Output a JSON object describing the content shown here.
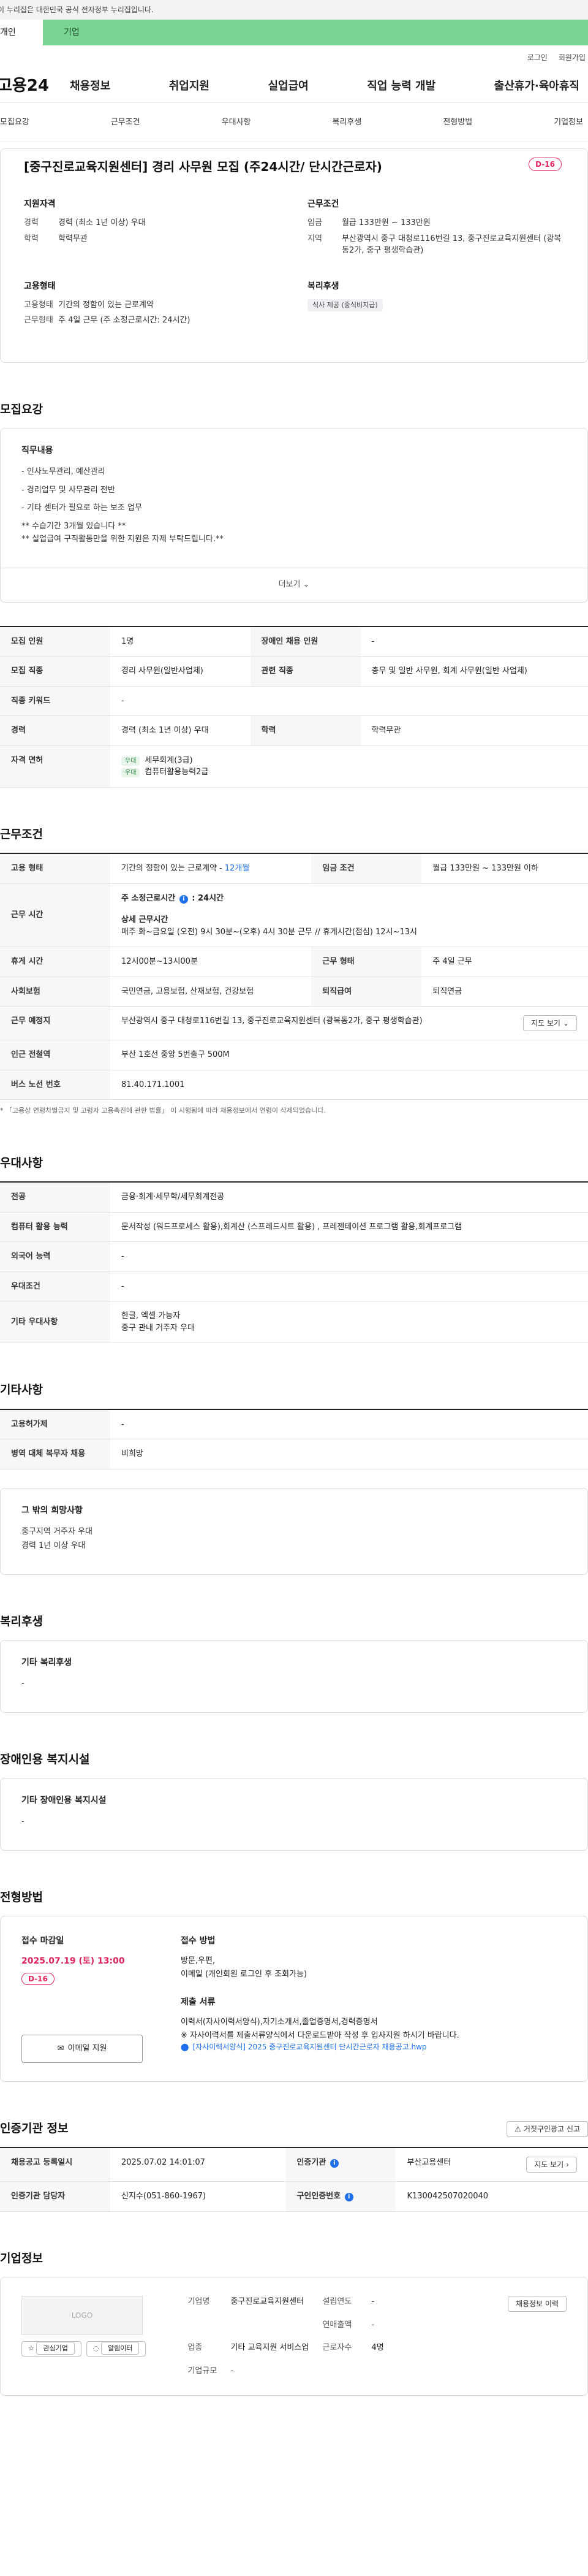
{
  "gov_notice": "이 누리집은 대한민국 공식 전자정부 누리집입니다.",
  "user_tabs": [
    "개인",
    "기업"
  ],
  "top_links": [
    "로그인",
    "회원가입"
  ],
  "logo": "고용24",
  "gnb": [
    "채용정보",
    "취업지원",
    "실업급여",
    "직업 능력 개발",
    "출산휴가·육아휴직"
  ],
  "anchors": [
    "모집요강",
    "근무조건",
    "우대사항",
    "복리후생",
    "전형방법",
    "기업정보"
  ],
  "job": {
    "title": "[중구진로교육지원센터] 경리 사무원 모집 (주24시간/ 단시간근로자)",
    "dday": "D-16",
    "summary": {
      "qual_title": "지원자격",
      "qual": [
        {
          "k": "경력",
          "v": "경력 (최소 1년 이상) 우대"
        },
        {
          "k": "학력",
          "v": "학력무관"
        }
      ],
      "cond_title": "근무조건",
      "cond": [
        {
          "k": "임금",
          "v": "월급 133만원 ~ 133만원"
        },
        {
          "k": "지역",
          "v": "부산광역시 중구 대청로116번길 13, 중구진로교육지원센터 (광복동2가, 중구 평생학습관)"
        }
      ],
      "emp_title": "고용형태",
      "emp": [
        {
          "k": "고용형태",
          "v": "기간의 정함이 있는 근로계약"
        },
        {
          "k": "근무형태",
          "v": "주 4일 근무 (주 소정근로시간: 24시간)"
        }
      ],
      "welfare_title": "복리후생",
      "welfare_chip": "식사 제공 (중식비지급)"
    }
  },
  "recruit": {
    "title": "모집요강",
    "duty_title": "직무내용",
    "duty_lines": [
      "- 인사노무관리, 예산관리",
      "- 경리업무 및 사무관리 전반",
      "- 기타 센터가 필요로 하는 보조 업무",
      "** 수습기간 3개월 있습니다 **",
      "** 실업급여 구직활동만을 위한 지원은 자제 부탁드립니다.**"
    ],
    "more": "더보기",
    "rows": [
      {
        "k": "모집 인원",
        "v": "1명",
        "k2": "장애인 채용 인원",
        "v2": "-"
      },
      {
        "k": "모집 직종",
        "v": "경리 사무원(일반사업체)",
        "k2": "관련 직종",
        "v2": "총무 및 일반 사무원, 회계 사무원(일반 사업체)"
      },
      {
        "k": "직종 키워드",
        "v": "-"
      },
      {
        "k": "경력",
        "v": "경력 (최소 1년 이상) 우대",
        "k2": "학력",
        "v2": "학력무관"
      }
    ],
    "license_k": "자격 면허",
    "licenses": [
      {
        "grade": "우대",
        "name": "세무회계(3급)"
      },
      {
        "grade": "우대",
        "name": "컴퓨터활용능력2급"
      }
    ]
  },
  "work": {
    "title": "근무조건",
    "emp_k": "고용 형태",
    "emp_v": "기간의 정함이 있는 근로계약 - ",
    "emp_v_blue": "12개월",
    "wage_k": "임금 조건",
    "wage_v": "월급 133만원 ~ 133만원 이하",
    "time_k": "근무 시간",
    "time_main": "주 소정근로시간",
    "time_hours": "24시간",
    "time_detail_title": "상세 근무시간",
    "time_detail": "매주 화~금요일 (오전) 9시 30분~(오후) 4시 30분 근무 // 휴게시간(점심) 12시~13시",
    "rest_k": "휴게 시간",
    "rest_v": "12시00분~13시00분",
    "form_k": "근무 형태",
    "form_v": "주 4일 근무",
    "ins_k": "사회보험",
    "ins_v": "국민연금, 고용보험, 산재보험, 건강보험",
    "ret_k": "퇴직급여",
    "ret_v": "퇴직연금",
    "place_k": "근무 예정지",
    "place_v": "부산광역시 중구 대청로116번길 13, 중구진로교육지원센터 (광복동2가, 중구 평생학습관)",
    "map_btn": "지도 보기",
    "subway_k": "인근 전철역",
    "subway_v": "부산 1호선 중앙 5번출구 500M",
    "bus_k": "버스 노선 번호",
    "bus_v": "81.40.171.1001",
    "note": "* 「고용상 연령차별금지 및 고령자 고용촉진에 관한 법률」 이 시행됨에 따라 채용정보에서 연령이 삭제되었습니다."
  },
  "pref": {
    "title": "우대사항",
    "rows": [
      {
        "k": "전공",
        "v": "금융·회계·세무학/세무회계전공"
      },
      {
        "k": "컴퓨터 활용 능력",
        "v": "문서작성 (워드프로세스 활용),회계산 (스프레드시트 활용) , 프레젠테이션 프로그램 활용,회계프로그램"
      },
      {
        "k": "외국어 능력",
        "v": "-"
      },
      {
        "k": "우대조건",
        "v": "-"
      }
    ],
    "etc_k": "기타 우대사항",
    "etc_lines": [
      "한글, 엑셀 가능자",
      "중구 관내 거주자 우대"
    ]
  },
  "other": {
    "title": "기타사항",
    "rows": [
      {
        "k": "고용허가제",
        "v": "-"
      },
      {
        "k": "병역 대체 복무자 채용",
        "v": "비희망"
      }
    ],
    "wish_title": "그 밖의 희망사항",
    "wish_lines": [
      "중구지역 거주자 우대",
      "경력 1년 이상 우대"
    ]
  },
  "welfare": {
    "title": "복리후생",
    "box_title": "기타 복리후생",
    "box_v": "-"
  },
  "disabled": {
    "title": "장애인용 복지시설",
    "box_title": "기타 장애인용 복지시설",
    "box_v": "-"
  },
  "process": {
    "title": "전형방법",
    "deadline_title": "접수 마감일",
    "deadline": "2025.07.19 (토) 13:00",
    "dday": "D-16",
    "email_btn": "이메일 지원",
    "method_title": "접수 방법",
    "methods": [
      "방문,우편,",
      "이메일 (개인회원 로그인 후 조회가능)"
    ],
    "docs_title": "제출 서류",
    "docs": [
      "이력서(자사이력서양식),자기소개서,졸업증명서,경력증명서",
      "※ 자사이력서를 제출서류양식에서 다운로드받아 작성 후 입사지원 하시기 바랍니다."
    ],
    "file": "[자사이력서양식] 2025 중구진로교육지원센터 단시간근로자 채용공고.hwp"
  },
  "agency": {
    "title": "인증기관 정보",
    "report_btn": "거짓구인광고 신고",
    "reg_k": "채용공고 등록일시",
    "reg_v": "2025.07.02 14:01:07",
    "org_k": "인증기관",
    "org_v": "부산고용센터",
    "map_btn": "지도 보기",
    "mgr_k": "인증기관 담당자",
    "mgr_v": "신지수(051-860-1967)",
    "no_k": "구인인증번호",
    "no_v": "K130042507020040"
  },
  "company": {
    "title": "기업정보",
    "logo": "LOGO",
    "fav_btn": "관심기업",
    "alarm_btn": "알림이터",
    "name_k": "기업명",
    "name_v": "중구진로교육지원센터",
    "year_k": "설립연도",
    "year_v": "-",
    "sales_k": "연매출액",
    "sales_v": "-",
    "ind_k": "업종",
    "ind_v": "기타 교육지원 서비스업",
    "emp_k": "근로자수",
    "emp_v": "4명",
    "size_k": "기업규모",
    "size_v": "-",
    "jobs_btn": "채용정보 이력"
  }
}
